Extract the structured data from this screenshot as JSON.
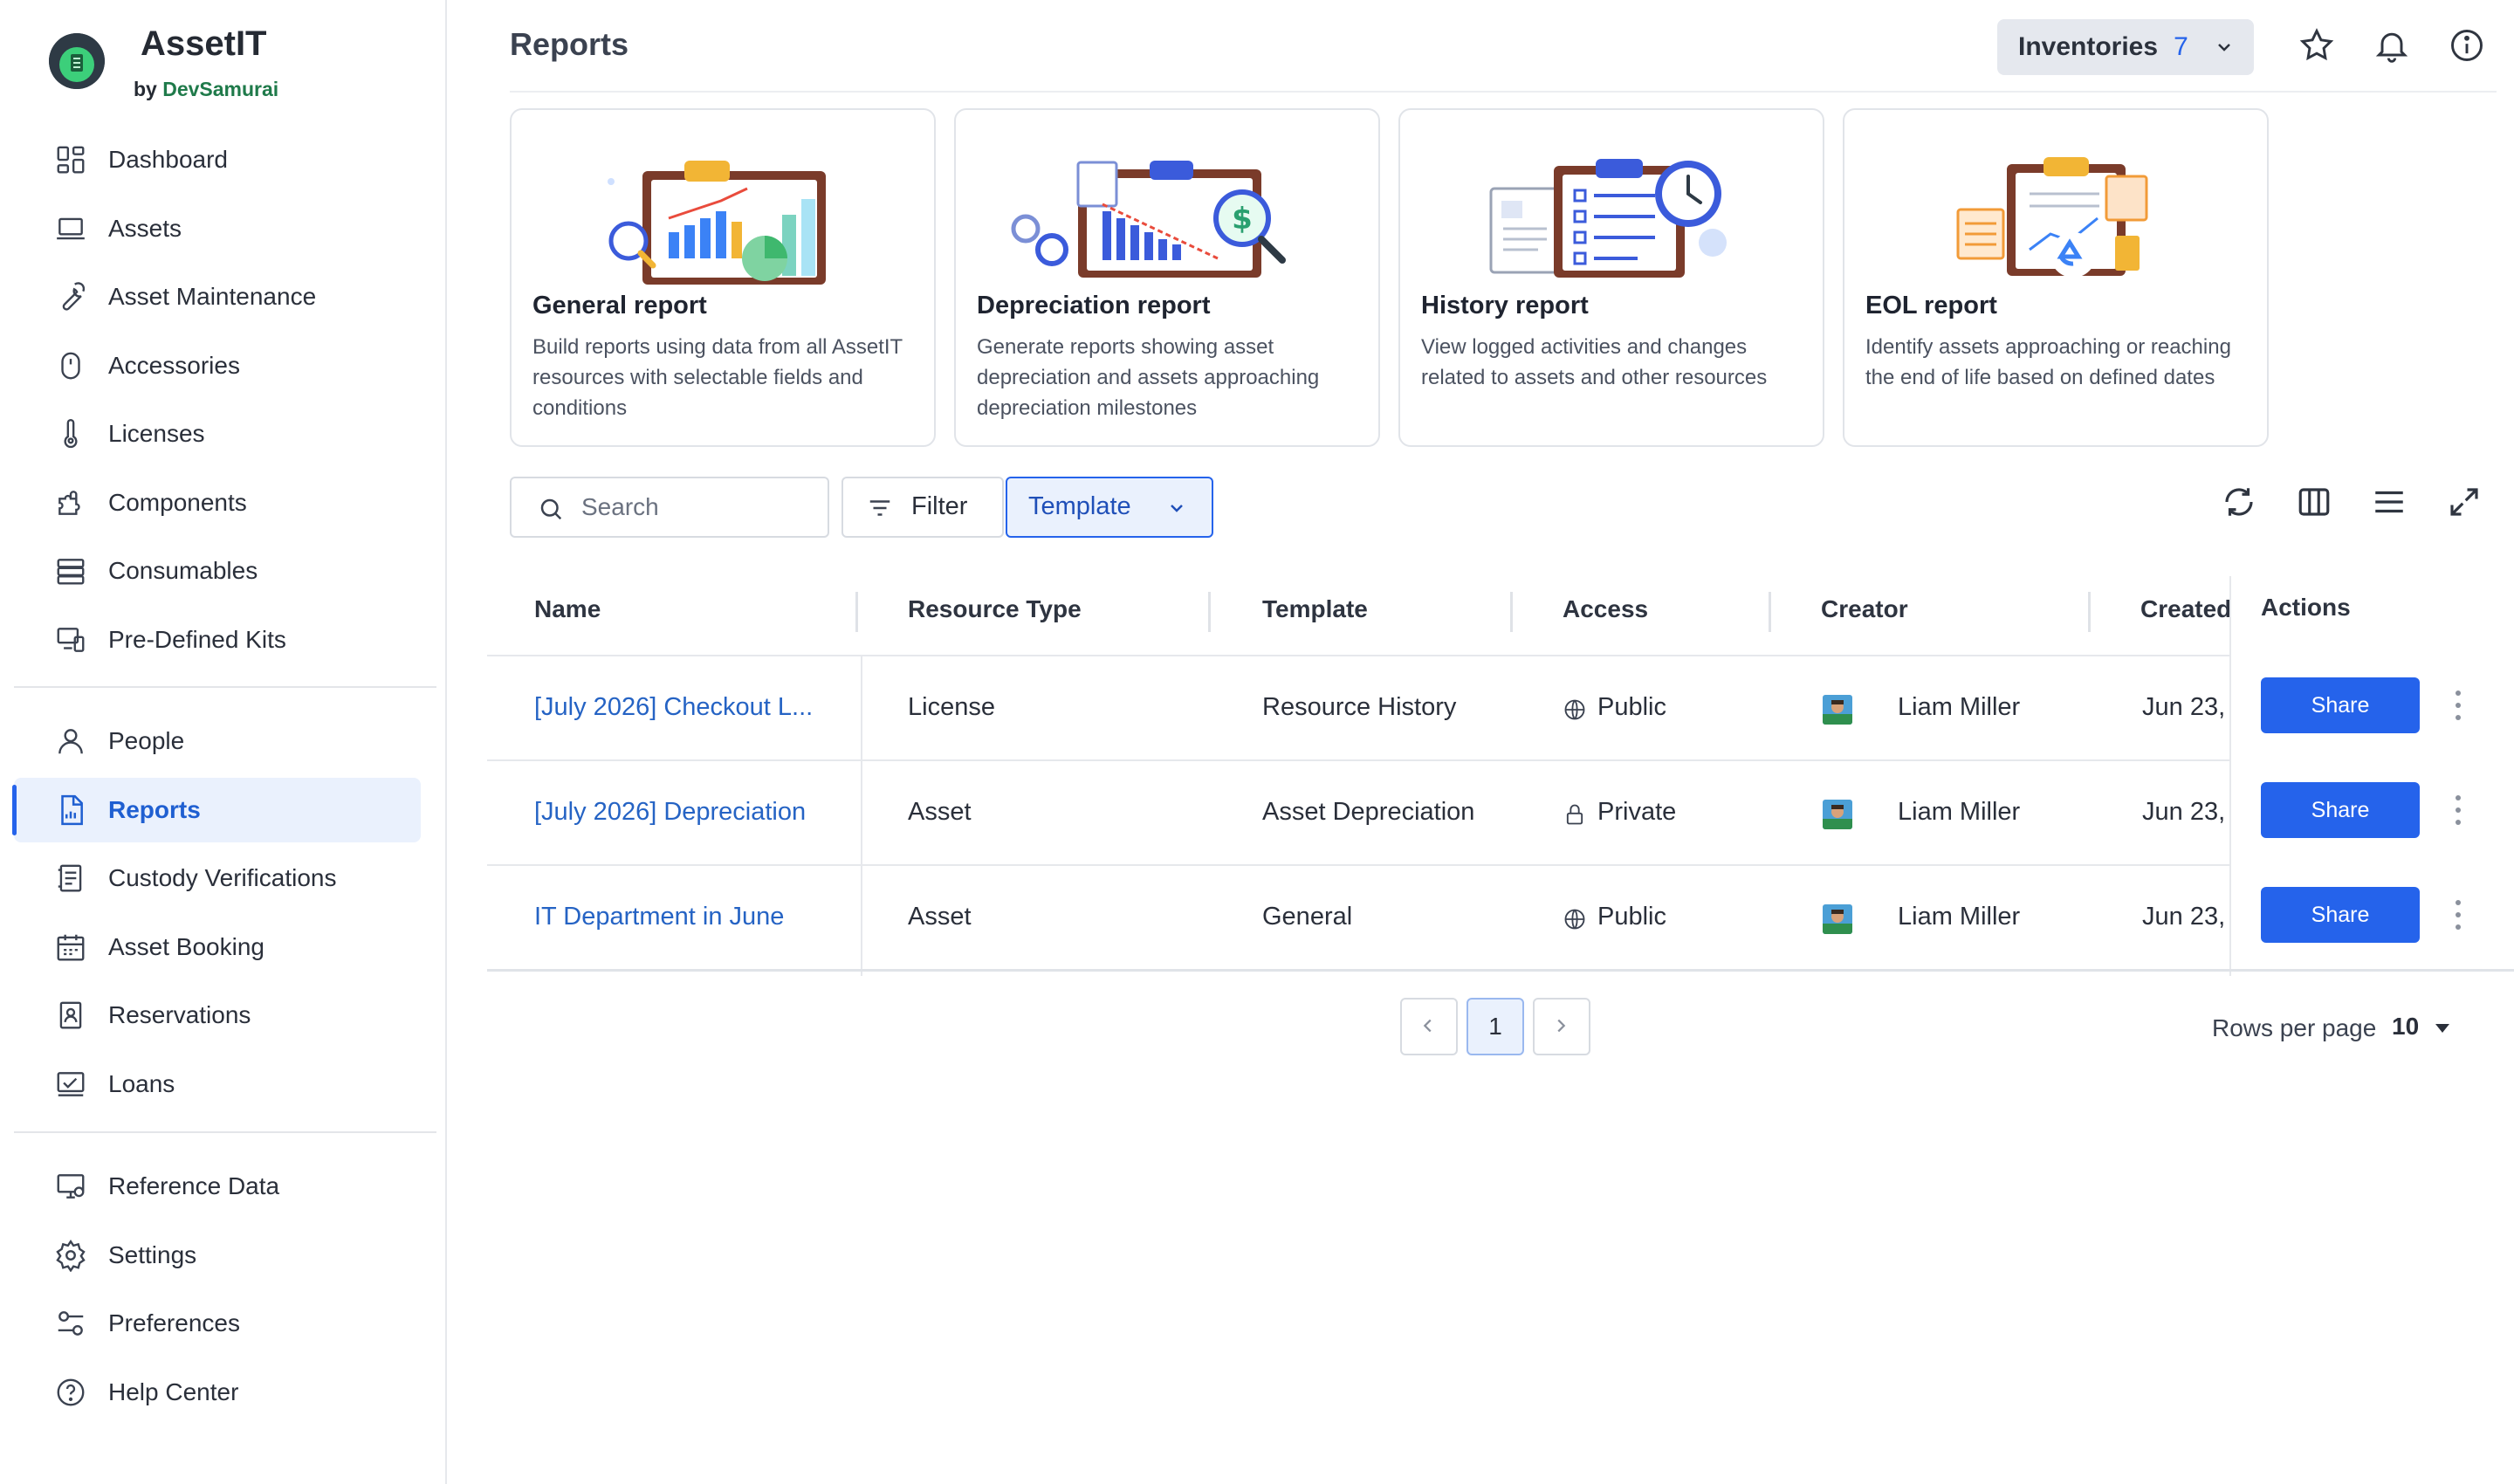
{
  "brand": {
    "name": "AssetIT",
    "by": "by",
    "company": "DevSamurai"
  },
  "sidebar": {
    "items": [
      {
        "label": "Dashboard",
        "icon": "dashboard-icon"
      },
      {
        "label": "Assets",
        "icon": "laptop-icon"
      },
      {
        "label": "Asset Maintenance",
        "icon": "wrench-icon"
      },
      {
        "label": "Accessories",
        "icon": "mouse-icon"
      },
      {
        "label": "Licenses",
        "icon": "thermometer-icon"
      },
      {
        "label": "Components",
        "icon": "puzzle-icon"
      },
      {
        "label": "Consumables",
        "icon": "layers-icon"
      },
      {
        "label": "Pre-Defined Kits",
        "icon": "devices-icon"
      },
      {
        "label": "People",
        "icon": "person-icon"
      },
      {
        "label": "Reports",
        "icon": "report-icon",
        "active": true
      },
      {
        "label": "Custody Verifications",
        "icon": "custody-icon"
      },
      {
        "label": "Asset Booking",
        "icon": "calendar-icon"
      },
      {
        "label": "Reservations",
        "icon": "badge-icon"
      },
      {
        "label": "Loans",
        "icon": "loan-icon"
      },
      {
        "label": "Reference Data",
        "icon": "monitor-icon"
      },
      {
        "label": "Settings",
        "icon": "gear-icon"
      },
      {
        "label": "Preferences",
        "icon": "sliders-icon"
      },
      {
        "label": "Help Center",
        "icon": "help-icon"
      }
    ]
  },
  "header": {
    "title": "Reports",
    "inventories_label": "Inventories",
    "inventories_count": "7"
  },
  "cards": [
    {
      "title": "General report",
      "desc": "Build reports using data from all AssetIT resources with selectable fields and conditions"
    },
    {
      "title": "Depreciation report",
      "desc": "Generate reports showing asset depreciation and assets approaching depreciation milestones"
    },
    {
      "title": "History report",
      "desc": "View logged activities and changes related to assets and other resources"
    },
    {
      "title": "EOL report",
      "desc": "Identify assets approaching or reaching the end of life based on defined dates"
    }
  ],
  "toolbar": {
    "search_placeholder": "Search",
    "filter_label": "Filter",
    "template_label": "Template"
  },
  "table": {
    "columns": [
      "Name",
      "Resource Type",
      "Template",
      "Access",
      "Creator",
      "Created",
      "Actions"
    ],
    "rows": [
      {
        "name": "[July 2026] Checkout L...",
        "resource_type": "License",
        "template": "Resource History",
        "access": "Public",
        "access_icon": "globe-icon",
        "creator": "Liam Miller",
        "created": "Jun 23,",
        "action": "Share"
      },
      {
        "name": "[July 2026] Depreciation",
        "resource_type": "Asset",
        "template": "Asset Depreciation",
        "access": "Private",
        "access_icon": "lock-icon",
        "creator": "Liam Miller",
        "created": "Jun 23,",
        "action": "Share"
      },
      {
        "name": "IT Department in June",
        "resource_type": "Asset",
        "template": "General",
        "access": "Public",
        "access_icon": "globe-icon",
        "creator": "Liam Miller",
        "created": "Jun 23,",
        "action": "Share"
      }
    ]
  },
  "pagination": {
    "current_page": "1",
    "rows_per_page_label": "Rows per page",
    "rows_per_page": "10"
  },
  "colors": {
    "accent": "#2563eb",
    "link": "#2563c4",
    "active_bg": "#eaf1fd",
    "brand_green": "#1f7a4a"
  }
}
